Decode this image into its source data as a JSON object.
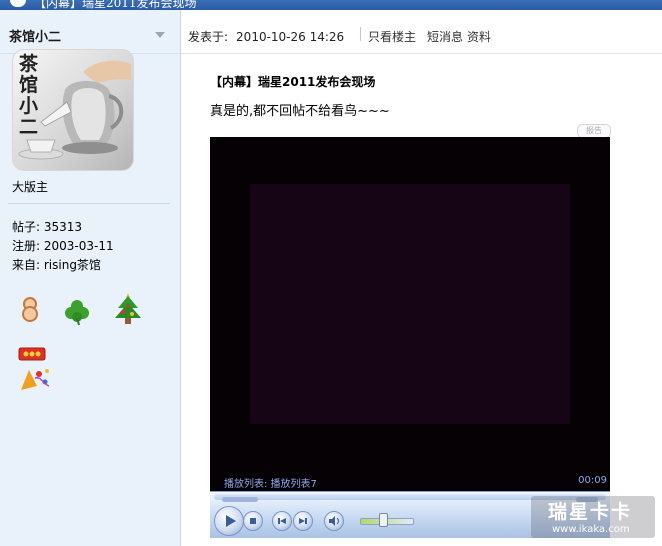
{
  "window": {
    "title": "【内幕】瑞星2011发布会现场"
  },
  "user": {
    "name": "茶馆小二",
    "avatar_text": "茶馆小二",
    "rank": "大版主",
    "posts": "帖子: 35313",
    "registered": "注册: 2003-03-11",
    "from": "来自: rising茶馆",
    "medals": [
      "medal-8-icon",
      "clover-icon",
      "christmas-tree-icon",
      "crown-medal-icon",
      "party-medal-icon"
    ]
  },
  "post": {
    "posted_label": "发表于:",
    "posted_time": "2010-10-26 14:26",
    "only_author": "只看楼主",
    "message": "短消息",
    "profile": "资料",
    "title": "【内幕】瑞星2011发布会现场",
    "body": "真是的,都不回帖不给看鸟~~~",
    "report_label": "报告"
  },
  "player": {
    "playlist": "播放列表: 播放列表7",
    "time": "00:09"
  },
  "watermark": {
    "title": "瑞星卡卡",
    "url": "www.ikaka.com"
  },
  "colors": {
    "sidebar_bg": "#e9f2fa",
    "title_bar": "#2a5aa4",
    "player_bg": "#050105",
    "player_text": "#8fa8e8"
  }
}
